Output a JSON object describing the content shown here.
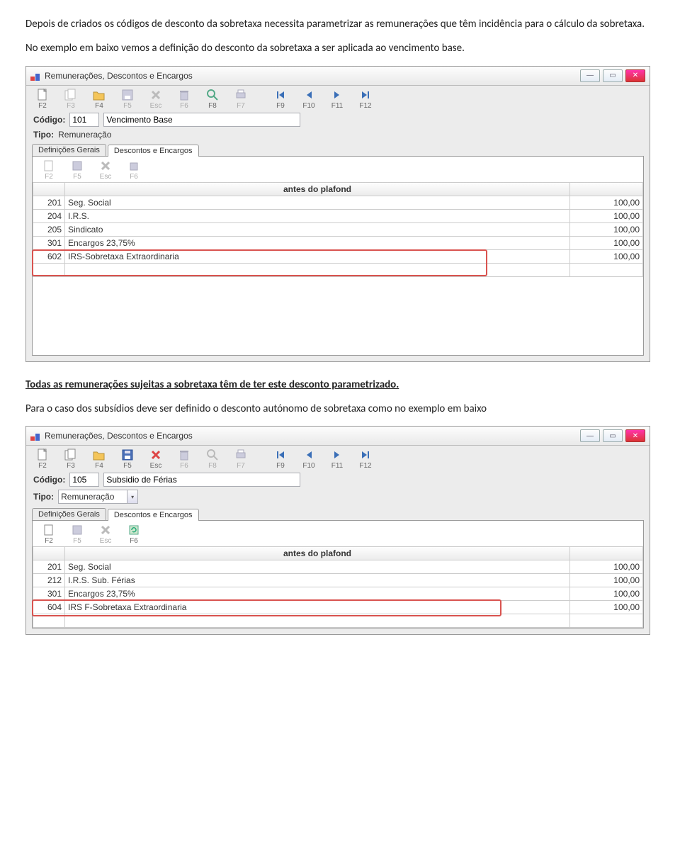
{
  "doc": {
    "p1": "Depois de criados os códigos de desconto da sobretaxa necessita parametrizar as remunerações que têm incidência para o cálculo da sobretaxa.",
    "p2": "No exemplo em baixo vemos a definição do desconto da sobretaxa a ser aplicada ao vencimento base.",
    "p3": "Todas as remunerações sujeitas a sobretaxa têm de ter este desconto parametrizado.",
    "p4": "Para o caso dos subsídios deve ser definido o desconto autónomo de sobretaxa como no exemplo em baixo"
  },
  "shared": {
    "window_title": "Remunerações, Descontos e Encargos",
    "tb": {
      "f2": "F2",
      "f3": "F3",
      "f4": "F4",
      "f5": "F5",
      "esc": "Esc",
      "f6": "F6",
      "f8": "F8",
      "f7": "F7",
      "f9": "F9",
      "f10": "F10",
      "f11": "F11",
      "f12": "F12"
    },
    "lbl_codigo": "Código:",
    "lbl_tipo": "Tipo:",
    "tab_def": "Definições Gerais",
    "tab_desc": "Descontos e Encargos",
    "subtb": {
      "f2": "F2",
      "f5": "F5",
      "esc": "Esc",
      "f6": "F6"
    },
    "grid_header": "antes do plafond"
  },
  "win1": {
    "codigo": "101",
    "codigo_desc": "Vencimento Base",
    "tipo": "Remuneração",
    "tipo_dd": false,
    "rows": [
      {
        "c": "201",
        "n": "Seg. Social",
        "v": "100,00"
      },
      {
        "c": "204",
        "n": "I.R.S.",
        "v": "100,00"
      },
      {
        "c": "205",
        "n": "Sindicato",
        "v": "100,00"
      },
      {
        "c": "301",
        "n": "Encargos 23,75%",
        "v": "100,00"
      },
      {
        "c": "602",
        "n": "IRS-Sobretaxa Extraordinaria",
        "v": "100,00"
      }
    ]
  },
  "win2": {
    "codigo": "105",
    "codigo_desc": "Subsidio de Férias",
    "tipo": "Remuneração",
    "tipo_dd": true,
    "rows": [
      {
        "c": "201",
        "n": "Seg. Social",
        "v": "100,00"
      },
      {
        "c": "212",
        "n": "I.R.S. Sub. Férias",
        "v": "100,00"
      },
      {
        "c": "301",
        "n": "Encargos 23,75%",
        "v": "100,00"
      },
      {
        "c": "604",
        "n": "IRS F-Sobretaxa Extraordinaria",
        "v": "100,00"
      }
    ]
  }
}
